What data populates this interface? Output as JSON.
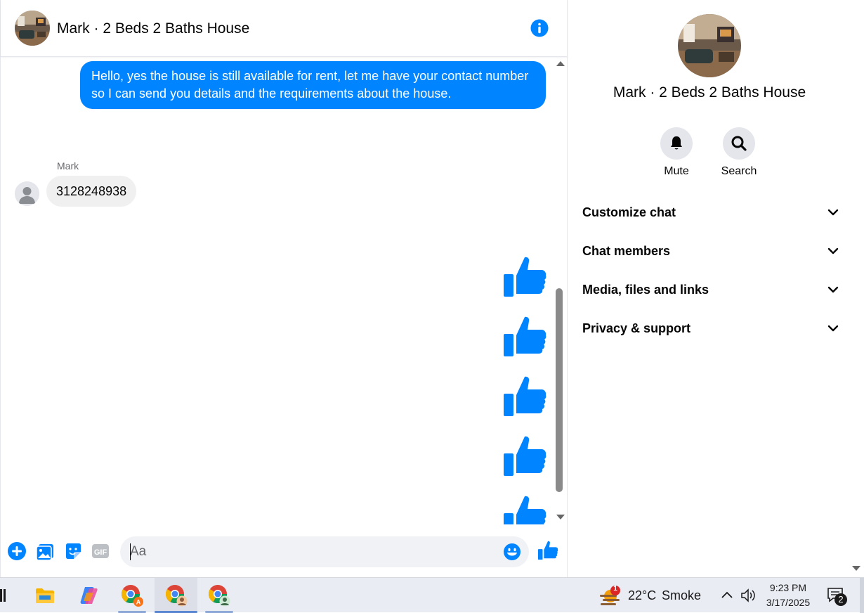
{
  "chat": {
    "title": "Mark · 2 Beds 2 Baths House",
    "outgoing_message": "Hello, yes the house is still available for rent, let me have your contact number so I can send you details and the requirements about the house.",
    "sender_name": "Mark",
    "incoming_message": "3128248938",
    "like_count_visible": 5
  },
  "composer": {
    "placeholder": "Aa"
  },
  "panel": {
    "title": "Mark · 2 Beds 2 Baths House",
    "actions": [
      {
        "label": "Mute",
        "icon": "bell-icon"
      },
      {
        "label": "Search",
        "icon": "search-icon"
      }
    ],
    "sections": [
      {
        "label": "Customize chat"
      },
      {
        "label": "Chat members"
      },
      {
        "label": "Media, files and links"
      },
      {
        "label": "Privacy & support"
      }
    ]
  },
  "taskbar": {
    "weather_temp": "22°C",
    "weather_desc": "Smoke",
    "weather_badge": "1",
    "time": "9:23 PM",
    "date": "3/17/2025",
    "notification_count": "2"
  },
  "colors": {
    "accent": "#0084ff",
    "bubble_in": "#f0f0f0",
    "taskbar": "#e9ecf3"
  }
}
